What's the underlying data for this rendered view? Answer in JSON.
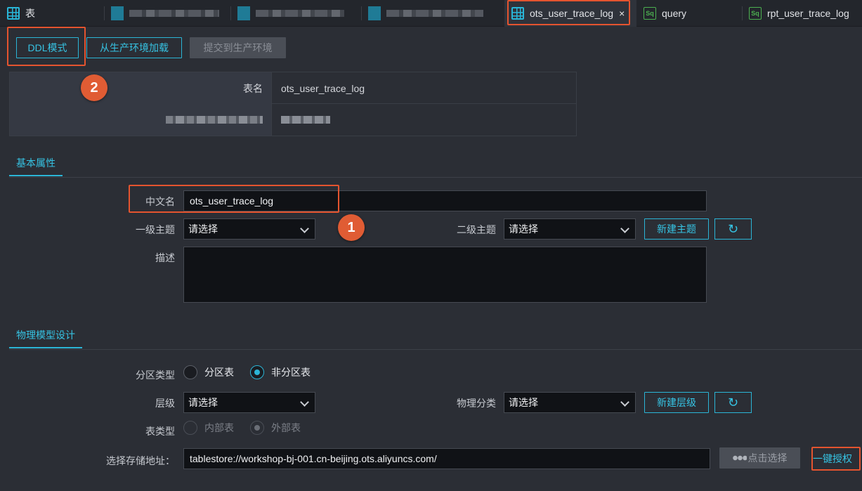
{
  "tabs": [
    {
      "label": "表",
      "icon": "table-icon"
    },
    {
      "label": "",
      "icon": "blurred-table-icon"
    },
    {
      "label": "",
      "icon": "blurred-table-icon"
    },
    {
      "label": "",
      "icon": "blurred-table-icon"
    },
    {
      "label": "ots_user_trace_log",
      "icon": "table-icon",
      "active": true,
      "close": "×"
    },
    {
      "label": "query",
      "icon": "sql-icon",
      "icon_text": "Sq"
    },
    {
      "label": "rpt_user_trace_log",
      "icon": "sql-icon",
      "icon_text": "Sq"
    }
  ],
  "toolbar": {
    "ddl_mode": "DDL模式",
    "load_from_prod": "从生产环境加载",
    "submit_to_prod": "提交到生产环境"
  },
  "badges": {
    "one": "1",
    "two": "2"
  },
  "info_table": {
    "table_name_label": "表名",
    "table_name_value": "ots_user_trace_log"
  },
  "basic": {
    "section_title": "基本属性",
    "cn_name_label": "中文名",
    "cn_name_value": "ots_user_trace_log",
    "level1_label": "一级主题",
    "level1_value": "请选择",
    "level2_label": "二级主题",
    "level2_value": "请选择",
    "new_topic": "新建主题",
    "desc_label": "描述",
    "refresh_icon": "↻"
  },
  "physical": {
    "section_title": "物理模型设计",
    "partition_type_label": "分区类型",
    "partition_option": "分区表",
    "non_partition_option": "非分区表",
    "layer_label": "层级",
    "layer_value": "请选择",
    "phys_class_label": "物理分类",
    "phys_class_value": "请选择",
    "new_layer": "新建层级",
    "table_type_label": "表类型",
    "internal_option": "内部表",
    "external_option": "外部表",
    "storage_label": "选择存储地址：",
    "storage_value": "tablestore://workshop-bj-001.cn-beijing.ots.aliyuncs.com/",
    "click_select": "点击选择",
    "one_click_auth": "一键授权"
  },
  "colors": {
    "accent": "#2bb5d6",
    "highlight": "#e4542f",
    "bg": "#2b2e35"
  }
}
